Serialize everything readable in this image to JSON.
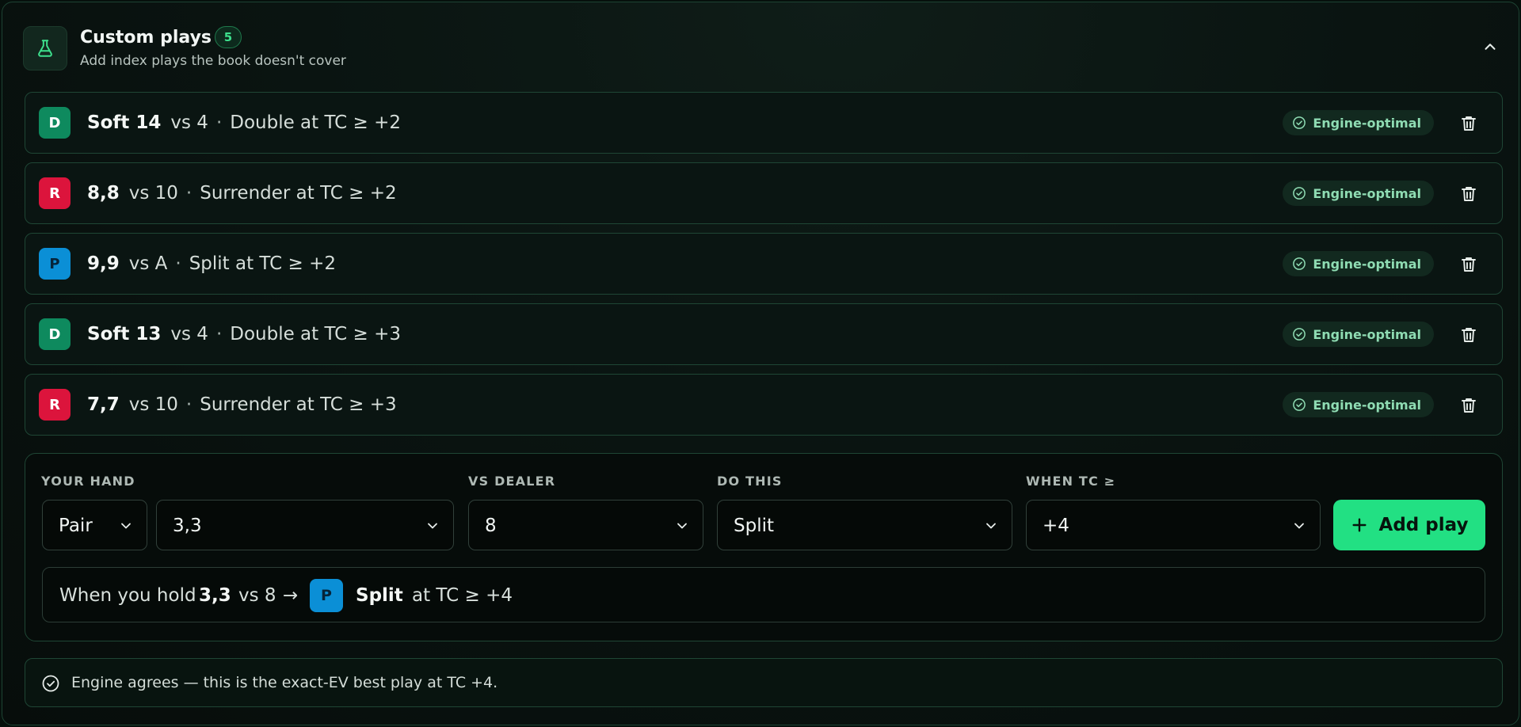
{
  "header": {
    "title": "Custom plays",
    "count": "5",
    "subtitle": "Add index plays the book doesn't cover",
    "icon": "flask-icon"
  },
  "colors": {
    "double": "#0e8a5e",
    "surrender": "#dc143c",
    "split": "#0b8fd6",
    "accent": "#22e083"
  },
  "plays": [
    {
      "action_letter": "D",
      "action": "double",
      "hand": "Soft 14",
      "vs": "vs 4",
      "dot": "·",
      "rule": "Double at TC ≥ +2",
      "status": "Engine-optimal"
    },
    {
      "action_letter": "R",
      "action": "surrender",
      "hand": "8,8",
      "vs": "vs 10",
      "dot": "·",
      "rule": "Surrender at TC ≥ +2",
      "status": "Engine-optimal"
    },
    {
      "action_letter": "P",
      "action": "split",
      "hand": "9,9",
      "vs": "vs A",
      "dot": "·",
      "rule": "Split at TC ≥ +2",
      "status": "Engine-optimal"
    },
    {
      "action_letter": "D",
      "action": "double",
      "hand": "Soft 13",
      "vs": "vs 4",
      "dot": "·",
      "rule": "Double at TC ≥ +3",
      "status": "Engine-optimal"
    },
    {
      "action_letter": "R",
      "action": "surrender",
      "hand": "7,7",
      "vs": "vs 10",
      "dot": "·",
      "rule": "Surrender at TC ≥ +3",
      "status": "Engine-optimal"
    }
  ],
  "form": {
    "your_hand_label": "YOUR HAND",
    "vs_dealer_label": "VS DEALER",
    "do_this_label": "DO THIS",
    "when_tc_label": "WHEN TC ≥",
    "hand_type": "Pair",
    "hand_value": "3,3",
    "dealer": "8",
    "action": "Split",
    "tc": "+4",
    "add_label": "Add play"
  },
  "preview": {
    "prefix": "When you hold",
    "hand": "3,3",
    "vs": "vs 8",
    "arrow": "→",
    "badge": "P",
    "action": "Split",
    "suffix": "at TC ≥ +4"
  },
  "status": {
    "text": "Engine agrees — this is the exact-EV best play at TC +4."
  }
}
